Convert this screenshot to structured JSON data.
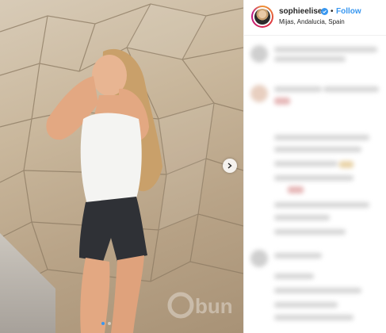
{
  "post": {
    "username": "sophieelise",
    "separator": "•",
    "follow_label": "Follow",
    "location": "Mijas, Andalucia, Spain"
  },
  "carousel": {
    "slide_count": 2,
    "active_index": 0
  },
  "colors": {
    "accent": "#3897f0",
    "text": "#262626",
    "border": "#efefef"
  },
  "icons": {
    "verified": "verified-badge-icon",
    "next": "chevron-right-icon"
  }
}
